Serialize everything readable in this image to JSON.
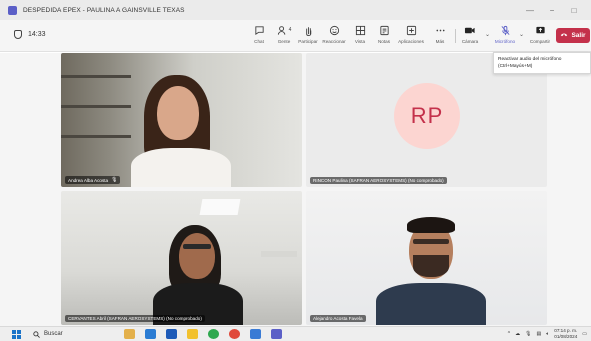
{
  "window": {
    "title": "DESPEDIDA EPEX - PAULINA A GAINSVILLE TEXAS",
    "controls": [
      "—",
      "−",
      "□"
    ]
  },
  "meeting": {
    "timer": "14:33",
    "toolbar": [
      {
        "label": "Chat",
        "icon": "chat-icon"
      },
      {
        "label": "Gente",
        "icon": "people-icon",
        "badge": "4"
      },
      {
        "label": "Participar",
        "icon": "raise-hand-icon"
      },
      {
        "label": "Reaccionar",
        "icon": "emoji-icon"
      },
      {
        "label": "Vista",
        "icon": "grid-view-icon"
      },
      {
        "label": "Notas",
        "icon": "notes-icon"
      },
      {
        "label": "Aplicaciones",
        "icon": "apps-icon"
      },
      {
        "label": "Más",
        "icon": "more-icon"
      },
      {
        "label": "Cámara",
        "icon": "camera-icon"
      },
      {
        "label": "Micrófono",
        "icon": "microphone-off-icon"
      },
      {
        "label": "Compartir",
        "icon": "share-icon"
      }
    ],
    "leave_label": "Salir",
    "tooltip": {
      "line1": "Reactivar audio del micrófono",
      "line2": "(Ctrl+Mayús+M)"
    },
    "participants": [
      {
        "name": "Andrea Alba Acosta",
        "muted": true
      },
      {
        "name": "RINCON Paulina (SAFRAN AEROSYSTEMS) (No comprobado)",
        "initials": "RP"
      },
      {
        "name": "CERVANTES Abril (SAFRAN AEROSYSTEMS) (No comprobado)"
      },
      {
        "name": "Alejandro Acosta Favela"
      }
    ]
  },
  "taskbar": {
    "search_label": "Buscar",
    "time": "07:14 p. m.",
    "date": "01/08/2024"
  },
  "colors": {
    "accent": "#5b5fc7",
    "leave": "#c4314b",
    "avatar_bg": "#fcd5d1"
  }
}
